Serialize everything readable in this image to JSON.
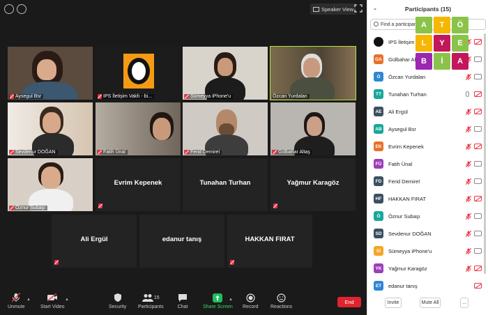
{
  "window": {
    "speaker_view_label": "Speaker View"
  },
  "tiles": [
    {
      "name": "Aysegul Bsr",
      "video": true
    },
    {
      "name": "IPS İletişim Vakfı  - bi...",
      "video": true
    },
    {
      "name": "Sümeyya iPhone'u",
      "video": true
    },
    {
      "name": "Özcan Yurdalan",
      "video": true,
      "active": true
    },
    {
      "name": "Sevdenur DOĞAN",
      "video": true
    },
    {
      "name": "Fatih Ünal",
      "video": true
    },
    {
      "name": "Ferid Demirel",
      "video": true
    },
    {
      "name": "Gülbahar Altaş",
      "video": true
    },
    {
      "name": "Öznur Subaşı",
      "video": true
    },
    {
      "name": "Evrim Kepenek",
      "video": false
    },
    {
      "name": "Tunahan Turhan",
      "video": false
    },
    {
      "name": "Yağmur Karagöz",
      "video": false
    },
    {
      "name": "Ali Ergül",
      "video": false
    },
    {
      "name": "edanur tanış",
      "video": false
    },
    {
      "name": "HAKKAN FIRAT",
      "video": false
    }
  ],
  "toolbar": {
    "unmute": "Unmute",
    "start_video": "Start Video",
    "security": "Security",
    "participants": "Participants",
    "participants_count": "15",
    "chat": "Chat",
    "share_screen": "Share Screen",
    "record": "Record",
    "reactions": "Reactions",
    "end": "End"
  },
  "panel": {
    "title": "Participants (15)",
    "search_placeholder": "Find a participant",
    "invite": "Invite",
    "mute_all": "Mute All",
    "more": "...",
    "logo_letters": [
      "A",
      "T",
      "Ö",
      "L",
      "Y",
      "E",
      "B",
      "İ",
      "A"
    ],
    "logo_colors": [
      "#8bc34a",
      "#f5b700",
      "#8bc34a",
      "#f5b700",
      "#c2185b",
      "#8bc34a",
      "#9c27b0",
      "#8bc34a",
      "#c2185b"
    ],
    "participants": [
      {
        "initials": "",
        "name": "IPS İletişim V",
        "color": "#111111",
        "mic": "muted",
        "cam": "off"
      },
      {
        "initials": "GA",
        "name": "Gülbahar Alt",
        "color": "#e8712c",
        "mic": "muted",
        "cam": "on"
      },
      {
        "initials": "Ö",
        "name": "Özcan Yurdalan",
        "color": "#2f86d4",
        "mic": "muted",
        "cam": "on"
      },
      {
        "initials": "TT",
        "name": "Tunahan Turhan",
        "color": "#1aa79b",
        "mic": "on",
        "cam": "off"
      },
      {
        "initials": "AE",
        "name": "Ali Ergül",
        "color": "#3c4f61",
        "mic": "muted",
        "cam": "off"
      },
      {
        "initials": "AB",
        "name": "Aysegul Bsr",
        "color": "#1aa79b",
        "mic": "muted",
        "cam": "on"
      },
      {
        "initials": "EK",
        "name": "Evrim Kepenek",
        "color": "#e8712c",
        "mic": "muted",
        "cam": "off"
      },
      {
        "initials": "FÜ",
        "name": "Fatih Ünal",
        "color": "#9b3fb8",
        "mic": "muted",
        "cam": "on"
      },
      {
        "initials": "FD",
        "name": "Ferid Demirel",
        "color": "#3c4f61",
        "mic": "muted",
        "cam": "on"
      },
      {
        "initials": "HF",
        "name": "HAKKAN FIRAT",
        "color": "#3c4f61",
        "mic": "muted",
        "cam": "off"
      },
      {
        "initials": "Ö",
        "name": "Öznur Subaşı",
        "color": "#1aa79b",
        "mic": "muted",
        "cam": "on"
      },
      {
        "initials": "SD",
        "name": "Sevdenur DOĞAN",
        "color": "#3c4f61",
        "mic": "muted",
        "cam": "on"
      },
      {
        "initials": "Sİ",
        "name": "Sümeyya iPhone'u",
        "color": "#f5a623",
        "mic": "muted",
        "cam": "on"
      },
      {
        "initials": "YK",
        "name": "Yağmur Karagöz",
        "color": "#9b3fb8",
        "mic": "muted",
        "cam": "off"
      },
      {
        "initials": "ET",
        "name": "edanur tanış",
        "color": "#2f86d4",
        "mic": "none",
        "cam": "off"
      }
    ]
  }
}
